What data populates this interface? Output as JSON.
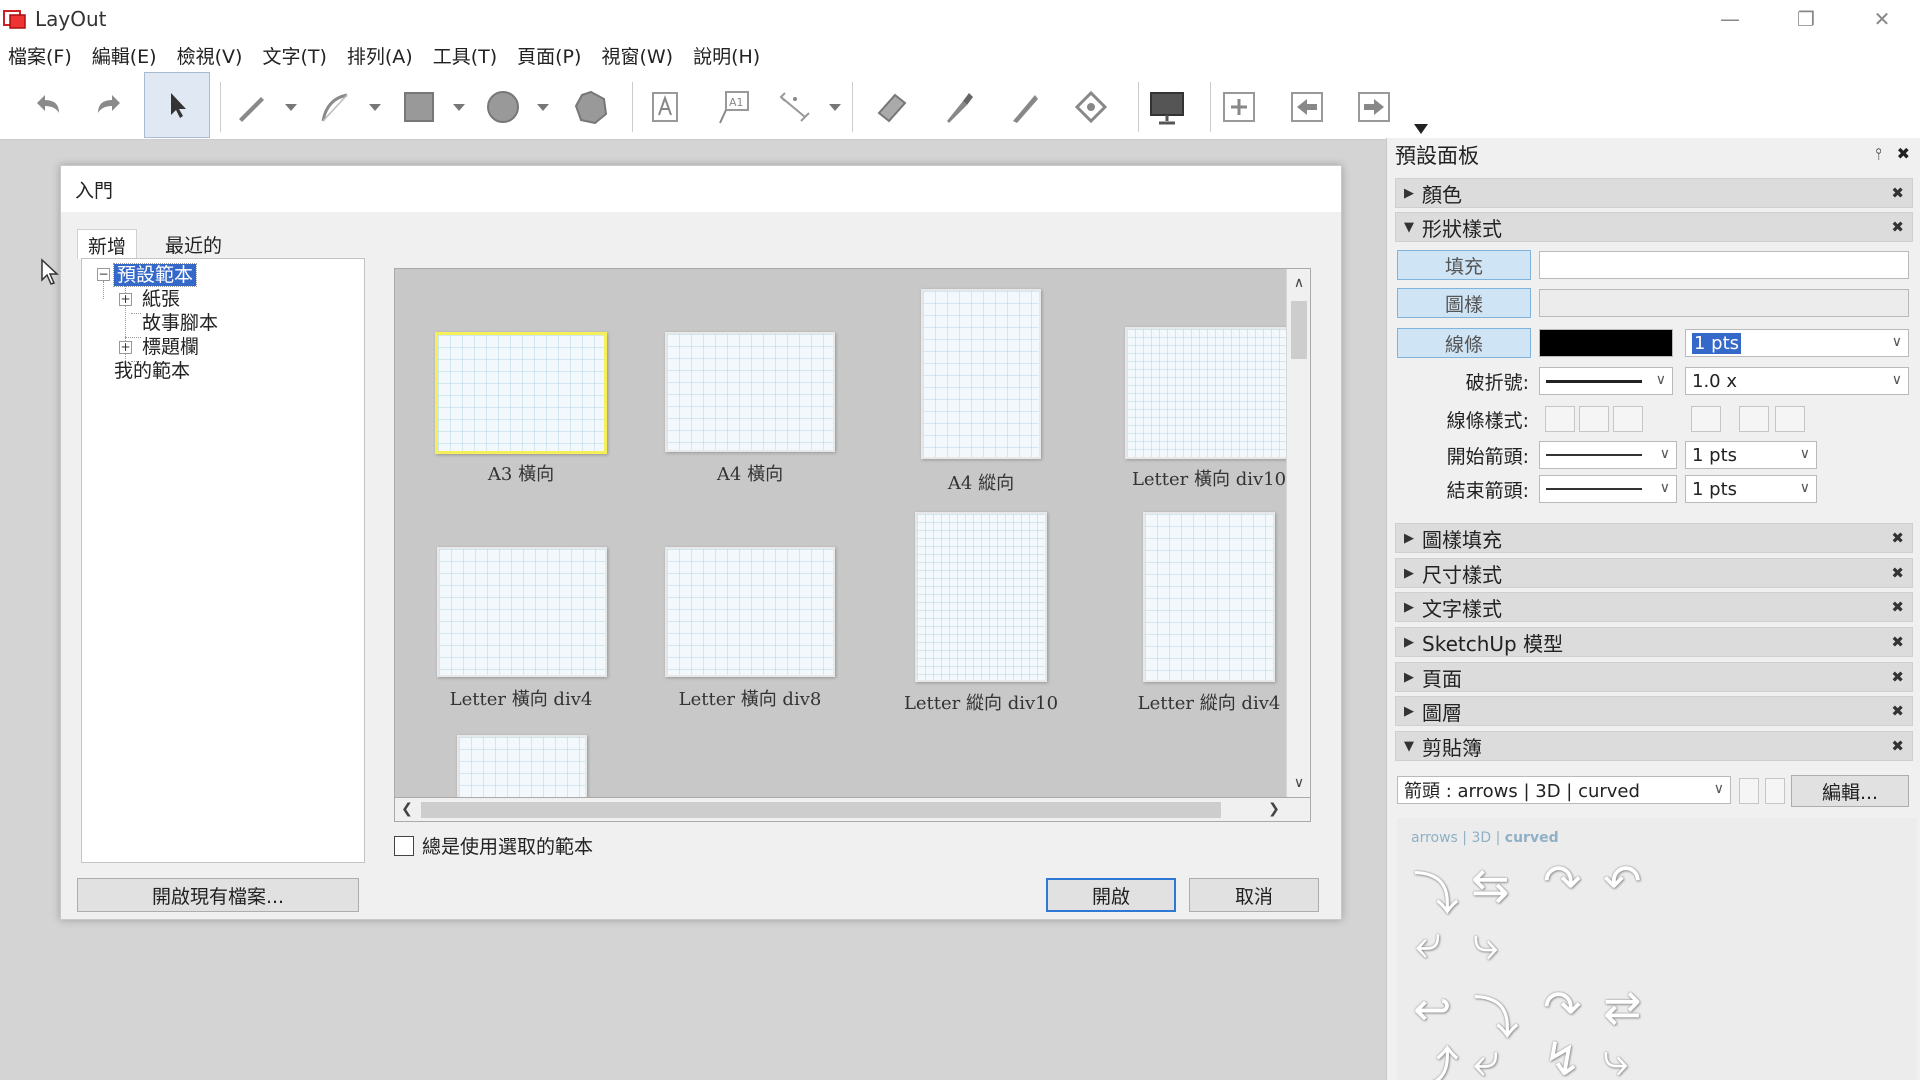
{
  "app": {
    "title": "LayOut",
    "window_controls": [
      "minimize",
      "maximize",
      "close"
    ]
  },
  "menu": [
    "檔案(F)",
    "編輯(E)",
    "檢視(V)",
    "文字(T)",
    "排列(A)",
    "工具(T)",
    "頁面(P)",
    "視窗(W)",
    "說明(H)"
  ],
  "toolbar": {
    "tools": [
      "undo-icon",
      "redo-icon",
      "select-icon",
      "line-icon",
      "arc-icon",
      "rectangle-icon",
      "circle-icon",
      "polygon-icon",
      "text-icon",
      "label-icon",
      "dimension-icon",
      "eraser-icon",
      "style-icon",
      "split-icon",
      "join-icon",
      "presentation-icon",
      "add-page-icon",
      "previous-page-icon",
      "next-page-icon"
    ]
  },
  "dialog": {
    "title": "入門",
    "tabs": [
      "新增",
      "最近的"
    ],
    "tree": [
      {
        "label": "預設範本"
      },
      {
        "label": "紙張"
      },
      {
        "label": "故事腳本"
      },
      {
        "label": "標題欄"
      },
      {
        "label": "我的範本"
      }
    ],
    "templates": [
      {
        "label": "A3 橫向"
      },
      {
        "label": "A4 橫向"
      },
      {
        "label": "A4 縱向"
      },
      {
        "label": "Letter 橫向 div10"
      },
      {
        "label": "Letter 橫向 div4"
      },
      {
        "label": "Letter 橫向 div8"
      },
      {
        "label": "Letter 縱向 div10"
      },
      {
        "label": "Letter 縱向 div4"
      }
    ],
    "always_use_label": "總是使用選取的範本",
    "open_existing_label": "開啟現有檔案...",
    "open_label": "開啟",
    "cancel_label": "取消"
  },
  "panel": {
    "title": "預設面板",
    "sections": {
      "colors": "顏色",
      "shape_style": "形狀樣式",
      "pattern_fill": "圖樣填充",
      "dimension_style": "尺寸樣式",
      "text_style": "文字樣式",
      "sketchup_model": "SketchUp 模型",
      "pages": "頁面",
      "layers": "圖層",
      "scrapbooks": "剪貼簿"
    },
    "shape_style": {
      "fill_label": "填充",
      "pattern_label": "圖樣",
      "stroke_label": "線條",
      "stroke_color": "#000000",
      "stroke_width": "1 pts",
      "dash_label": "破折號:",
      "dash_scale": "1.0 x",
      "line_style_label": "線條樣式:",
      "start_arrow_label": "開始箭頭:",
      "start_arrow_size": "1 pts",
      "end_arrow_label": "結束箭頭:",
      "end_arrow_size": "1 pts"
    },
    "scrapbook": {
      "selected": "箭頭 : arrows | 3D | curved",
      "edit_label": "編輯...",
      "preview_label_prefix": "arrows | 3D | ",
      "preview_label_bold": "curved"
    }
  },
  "colors": {
    "accent": "#2f78d6",
    "selection": "#3468c9",
    "thumb_highlight": "#f5ef5a"
  }
}
